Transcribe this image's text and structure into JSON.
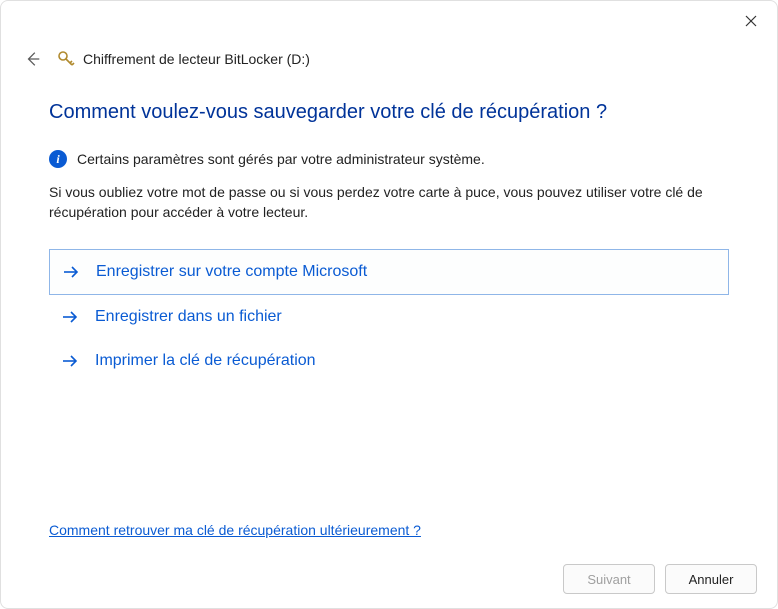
{
  "window": {
    "title": "Chiffrement de lecteur BitLocker (D:)"
  },
  "heading": "Comment voulez-vous sauvegarder votre clé de récupération ?",
  "info_text": "Certains paramètres sont gérés par votre administrateur système.",
  "body_text": "Si vous oubliez votre mot de passe ou si vous perdez votre carte à puce, vous pouvez utiliser votre clé de récupération pour accéder à votre lecteur.",
  "options": [
    {
      "label": "Enregistrer sur votre compte Microsoft",
      "selected": true
    },
    {
      "label": "Enregistrer dans un fichier",
      "selected": false
    },
    {
      "label": "Imprimer la clé de récupération",
      "selected": false
    }
  ],
  "help_link": "Comment retrouver ma clé de récupération ultérieurement ?",
  "buttons": {
    "next": "Suivant",
    "cancel": "Annuler"
  },
  "icons": {
    "header_icon": "bitlocker-key-icon",
    "info_icon": "info-icon"
  }
}
